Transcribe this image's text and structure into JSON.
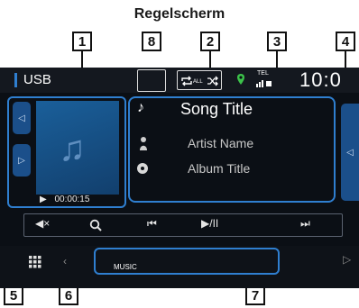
{
  "page": {
    "heading": "Regelscherm"
  },
  "callouts": [
    "1",
    "2",
    "3",
    "4",
    "5",
    "6",
    "7",
    "8"
  ],
  "topbar": {
    "source": "USB",
    "repeat_label": "ALL",
    "tel_label": "TEL",
    "clock": "10:0"
  },
  "track": {
    "song_title": "Song Title",
    "artist": "Artist Name",
    "album": "Album Title",
    "elapsed": "00:00:15"
  },
  "controls": [
    "mute",
    "search",
    "previous",
    "play-pause",
    "next"
  ],
  "bottom": {
    "media_label": "MUSIC"
  },
  "colors": {
    "accent": "#2f7fd0",
    "screen_bg": "#0b0f15",
    "art": "#1a5f9a",
    "callout_border": "#111111"
  }
}
